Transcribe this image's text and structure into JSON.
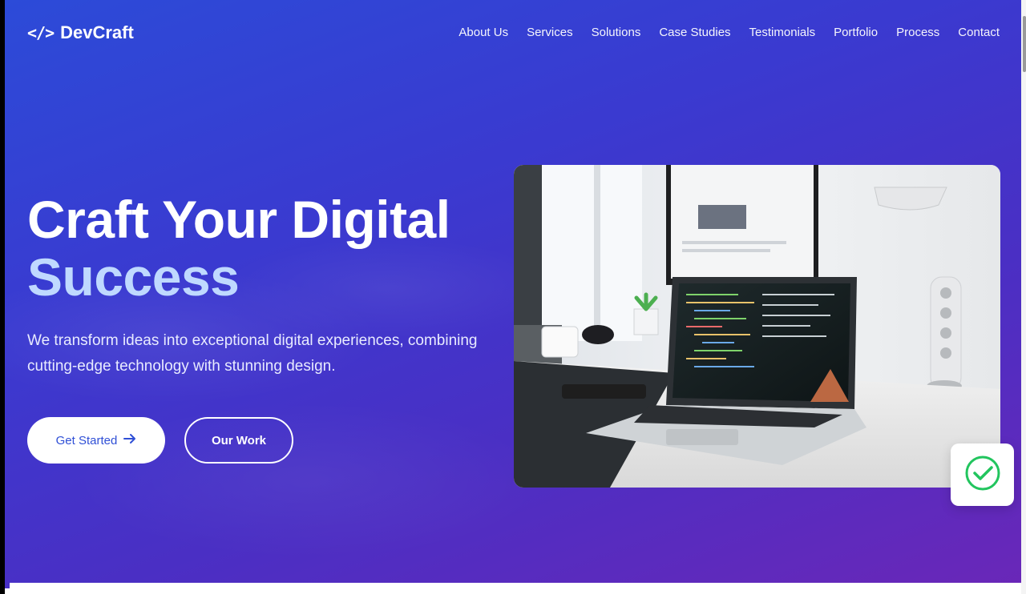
{
  "brand": {
    "icon": "</>",
    "name": "DevCraft",
    "icon_name": "code-icon"
  },
  "nav": {
    "items": [
      {
        "label": "About Us"
      },
      {
        "label": "Services"
      },
      {
        "label": "Solutions"
      },
      {
        "label": "Case Studies"
      },
      {
        "label": "Testimonials"
      },
      {
        "label": "Portfolio"
      },
      {
        "label": "Process"
      },
      {
        "label": "Contact"
      }
    ]
  },
  "hero": {
    "title_line1": "Craft Your Digital",
    "title_line2": "Success",
    "subtitle": "We transform ideas into exceptional digital experiences, combining cutting-edge technology with stunning design.",
    "primary_button": "Get Started",
    "primary_button_icon": "arrow-right-icon",
    "secondary_button": "Our Work",
    "image_name": "laptop-workspace-photo",
    "badge_icon": "check-circle-icon"
  },
  "colors": {
    "gradient_start": "#2c4bd8",
    "gradient_end": "#6a27b8",
    "title_accent": "#bfd9ff",
    "primary_button_text": "#2f4fd6",
    "badge_check": "#22c55e"
  }
}
